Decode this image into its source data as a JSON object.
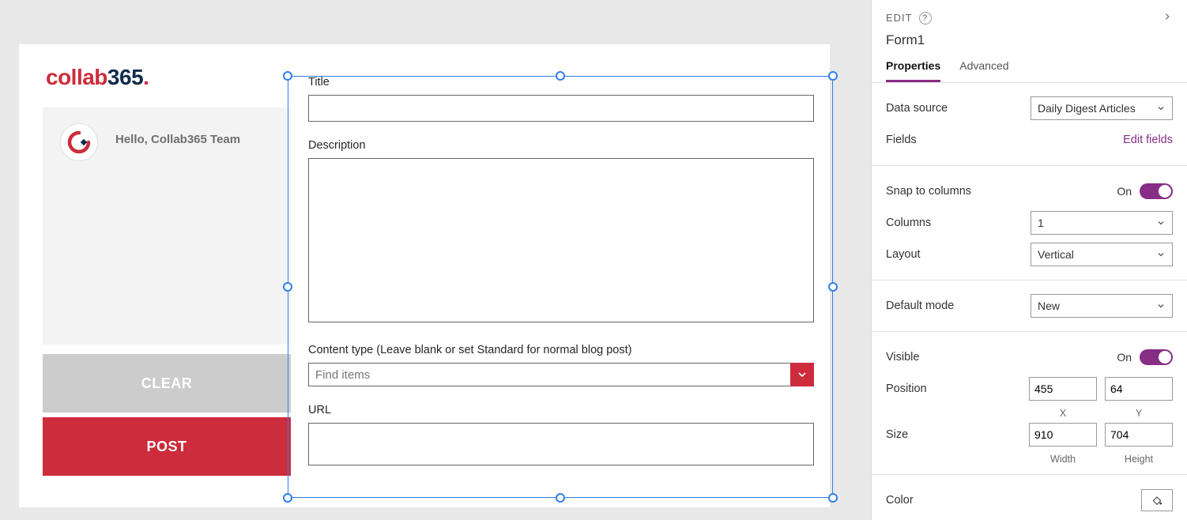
{
  "logo": {
    "part1": "collab",
    "part2": "365",
    "dot": "."
  },
  "greeting": "Hello, Collab365 Team",
  "buttons": {
    "clear": "CLEAR",
    "post": "POST"
  },
  "form": {
    "title_label": "Title",
    "title_value": "",
    "description_label": "Description",
    "description_value": "",
    "contenttype_label": "Content type (Leave blank or set Standard for normal blog post)",
    "contenttype_placeholder": "Find items",
    "url_label": "URL",
    "url_value": ""
  },
  "panel": {
    "edit_caption": "EDIT",
    "object_name": "Form1",
    "tabs": {
      "properties": "Properties",
      "advanced": "Advanced"
    },
    "datasource": {
      "label": "Data source",
      "value": "Daily Digest Articles"
    },
    "fields": {
      "label": "Fields",
      "link": "Edit fields"
    },
    "snap": {
      "label": "Snap to columns",
      "state": "On"
    },
    "columns": {
      "label": "Columns",
      "value": "1"
    },
    "layout": {
      "label": "Layout",
      "value": "Vertical"
    },
    "defaultmode": {
      "label": "Default mode",
      "value": "New"
    },
    "visible": {
      "label": "Visible",
      "state": "On"
    },
    "position": {
      "label": "Position",
      "x": "455",
      "y": "64",
      "xl": "X",
      "yl": "Y"
    },
    "size": {
      "label": "Size",
      "w": "910",
      "h": "704",
      "wl": "Width",
      "hl": "Height"
    },
    "color": {
      "label": "Color"
    }
  }
}
